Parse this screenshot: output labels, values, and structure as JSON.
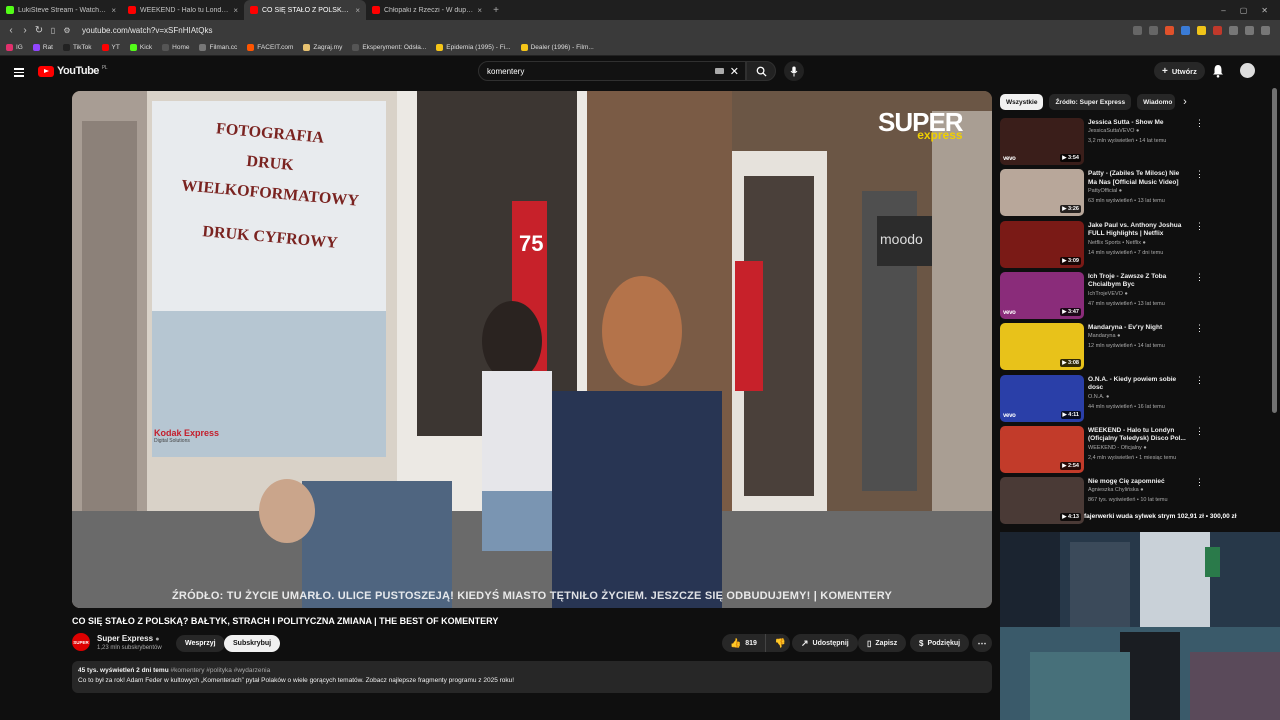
{
  "browser": {
    "tabs": [
      {
        "title": "LukiSteve Stream - Watch Live on",
        "color": "#53fc18",
        "active": false
      },
      {
        "title": "WEEKEND - Halo tu Londyn (Oficjaln",
        "color": "#ff0000",
        "active": false
      },
      {
        "title": "CO SIĘ STAŁO Z POLSKĄ? BAŁ",
        "color": "#ff0000",
        "active": true
      },
      {
        "title": "Chłopaki z Rzeczi - W dupie mam co",
        "color": "#ff0000",
        "active": false
      }
    ],
    "url": "youtube.com/watch?v=xSFnHIAtQks",
    "bookmarks": [
      {
        "label": "IG",
        "color": "#e1306c"
      },
      {
        "label": "Rat",
        "color": "#9146ff"
      },
      {
        "label": "TikTok",
        "color": "#222222"
      },
      {
        "label": "YT",
        "color": "#ff0000"
      },
      {
        "label": "Kick",
        "color": "#53fc18"
      },
      {
        "label": "Home",
        "color": "#555555"
      },
      {
        "label": "Filman.cc",
        "color": "#777777"
      },
      {
        "label": "FACEIT.com",
        "color": "#ff5500"
      },
      {
        "label": "Zagraj.my",
        "color": "#e8c270"
      },
      {
        "label": "Eksperyment: Odsła...",
        "color": "#555555"
      },
      {
        "label": "Epidemia (1995) - Fi...",
        "color": "#f5c518"
      },
      {
        "label": "Dealer (1996) - Film...",
        "color": "#f5c518"
      }
    ]
  },
  "youtube": {
    "logo": "YouTube",
    "logo_region": "PL",
    "search_value": "komentery",
    "create_label": "Utwórz"
  },
  "video": {
    "caption": "ŹRÓDŁO: TU ŻYCIE UMARŁO. ULICE PUSTOSZEJĄ! KIEDYŚ MIASTO TĘTNIŁO ŻYCIEM. JESZCZE SIĘ ODBUDUJEMY! | KOMENTERY",
    "scene_sign_lines": [
      "FOTOGRAFIA",
      "DRUK",
      "WIELKOFORMATOWY",
      "DRUK CYFROWY"
    ],
    "scene_brand": "Kodak Express",
    "scene_brand_sub": "Digital Solutions",
    "watermark_main": "SUPER",
    "watermark_sub": "express",
    "store_sign": "moodo",
    "sale_sign": "75",
    "title": "CO SIĘ STAŁO Z POLSKĄ? BAŁTYK, STRACH I POLITYCZNA ZMIANA | THE BEST OF KOMENTERY",
    "channel": {
      "name": "Super Express",
      "subs": "1,23 mln subskrybentów",
      "avatar_text": "SUPER"
    },
    "join_label": "Wesprzyj",
    "subscribe_label": "Subskrybuj",
    "likes": "819",
    "share_label": "Udostępnij",
    "save_label": "Zapisz",
    "thanks_label": "Podziękuj",
    "desc_stats": "45 tys. wyświetleń  2 dni temu",
    "desc_tags": "#komentery #polityka #wydarzenia",
    "desc_text": "Co to był za rok! Adam Feder w kultowych „Komenterach” pytał Polaków o wiele gorących tematów. Zobacz najlepsze fragmenty programu z 2025 roku!"
  },
  "chips": [
    "Wszystkie",
    "Źródło: Super Express",
    "Wiadomo"
  ],
  "recommendations": [
    {
      "title": "Jessica Sutta - Show Me",
      "channel": "JessicaSuttaVEVO",
      "meta": "3,2 mln wyświetleń • 14 lat temu",
      "duration": "3:54",
      "vevo": true,
      "thumb": "#3a1e1a"
    },
    {
      "title": "Patty - (Zabiles Te Milosc) Nie Ma Nas [Official Music Video]",
      "channel": "PattyOfficial",
      "meta": "63 mln wyświetleń • 13 lat temu",
      "duration": "3:26",
      "vevo": false,
      "thumb": "#b8a79a"
    },
    {
      "title": "Jake Paul vs. Anthony Joshua FULL Highlights | Netflix",
      "channel": "Netflix Sports • Netflix",
      "meta": "14 mln wyświetleń • 7 dni temu",
      "duration": "3:09",
      "vevo": false,
      "thumb": "#7a1a16"
    },
    {
      "title": "Ich Troje - Zawsze Z Toba Chcialbym Byc",
      "channel": "IchTrojeVEVO",
      "meta": "47 mln wyświetleń • 13 lat temu",
      "duration": "3:47",
      "vevo": true,
      "thumb": "#8a2c7a"
    },
    {
      "title": "Mandaryna - Ev'ry Night",
      "channel": "Mandaryna",
      "meta": "12 mln wyświetleń • 14 lat temu",
      "duration": "3:08",
      "vevo": false,
      "thumb": "#e8c21a"
    },
    {
      "title": "O.N.A. - Kiedy powiem sobie dosc",
      "channel": "O.N.A.",
      "meta": "44 mln wyświetleń • 16 lat temu",
      "duration": "4:11",
      "vevo": true,
      "thumb": "#2a3fa8"
    },
    {
      "title": "WEEKEND - Halo tu Londyn (Oficjalny Teledysk) Disco Pol...",
      "channel": "WEEKEND - Oficjalny",
      "meta": "2,4 mln wyświetleń • 1 miesiąc temu",
      "duration": "2:54",
      "vevo": false,
      "thumb": "#c23b2a"
    },
    {
      "title": "Nie mogę Cię zapomnieć",
      "channel": "Agnieszka Chylińska",
      "meta": "867 tys. wyświetleń • 10 lat temu",
      "duration": "4:13",
      "vevo": false,
      "thumb": "#4a3a36"
    }
  ],
  "stream_overlay": "fajerwerki wuda sylwek strym  102,91 zł  •  300,00 zł"
}
